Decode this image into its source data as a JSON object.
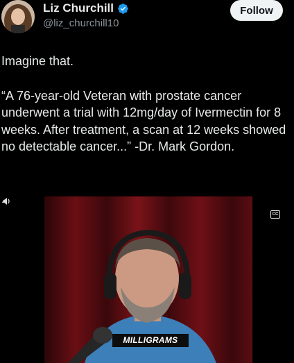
{
  "author": {
    "name": "Liz Churchill",
    "handle": "@liz_churchill10",
    "verified": true,
    "avatar_icon": "profile-photo",
    "verified_icon": "verified-badge-icon"
  },
  "follow_label": "Follow",
  "tweet": {
    "line1": "Imagine that.",
    "quote": "“A 76-year-old Veteran with prostate cancer underwent a trial with 12mg/day of Ivermectin for 8 weeks. After treatment, a scan at 12 weeks showed no detectable cancer...” -Dr. Mark Gordon."
  },
  "video": {
    "caption": "MILLIGRAMS",
    "cc_label": "CC"
  },
  "colors": {
    "background": "#000000",
    "text": "#e7e9ea",
    "muted": "#8b9299",
    "verified": "#1d9bf0",
    "follow_bg": "#eff3f4"
  }
}
